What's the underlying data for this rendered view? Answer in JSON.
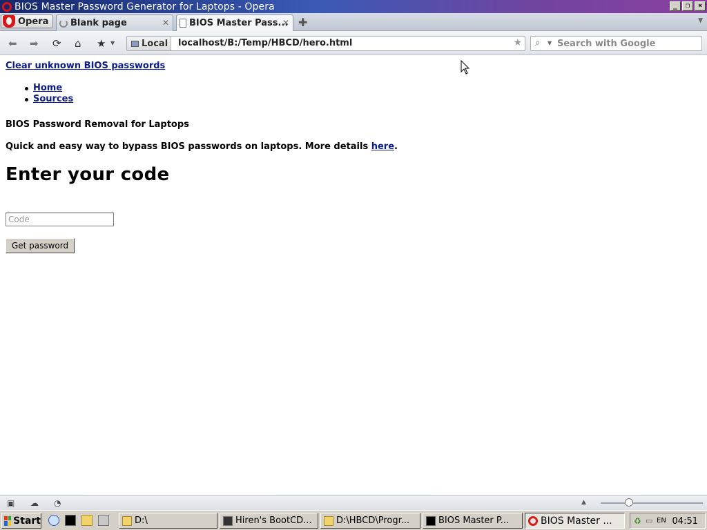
{
  "window": {
    "title": "BIOS Master Password Generator for Laptops - Opera"
  },
  "tabs": {
    "menu_label": "Opera",
    "items": [
      {
        "label": "Blank page"
      },
      {
        "label": "BIOS Master Pass..."
      }
    ]
  },
  "navbar": {
    "local_label": "Local",
    "url": "localhost/B:/Temp/HBCD/hero.html",
    "search_placeholder": "Search with Google"
  },
  "page": {
    "site_link": "Clear unknown BIOS passwords",
    "nav": [
      "Home",
      "Sources"
    ],
    "subtitle": "BIOS Password Removal for Laptops",
    "description": "Quick and easy way to bypass BIOS passwords on laptops. More details ",
    "description_link": "here",
    "description_end": ".",
    "heading": "Enter your code",
    "code_placeholder": "Code",
    "button_label": "Get password"
  },
  "taskbar": {
    "start_label": "Start",
    "buttons": [
      {
        "label": "D:\\"
      },
      {
        "label": "Hiren's BootCD..."
      },
      {
        "label": "D:\\HBCD\\Progr..."
      },
      {
        "label": "BIOS Master P..."
      },
      {
        "label": "BIOS Master ..."
      }
    ],
    "language": "EN",
    "clock": "04:51"
  }
}
